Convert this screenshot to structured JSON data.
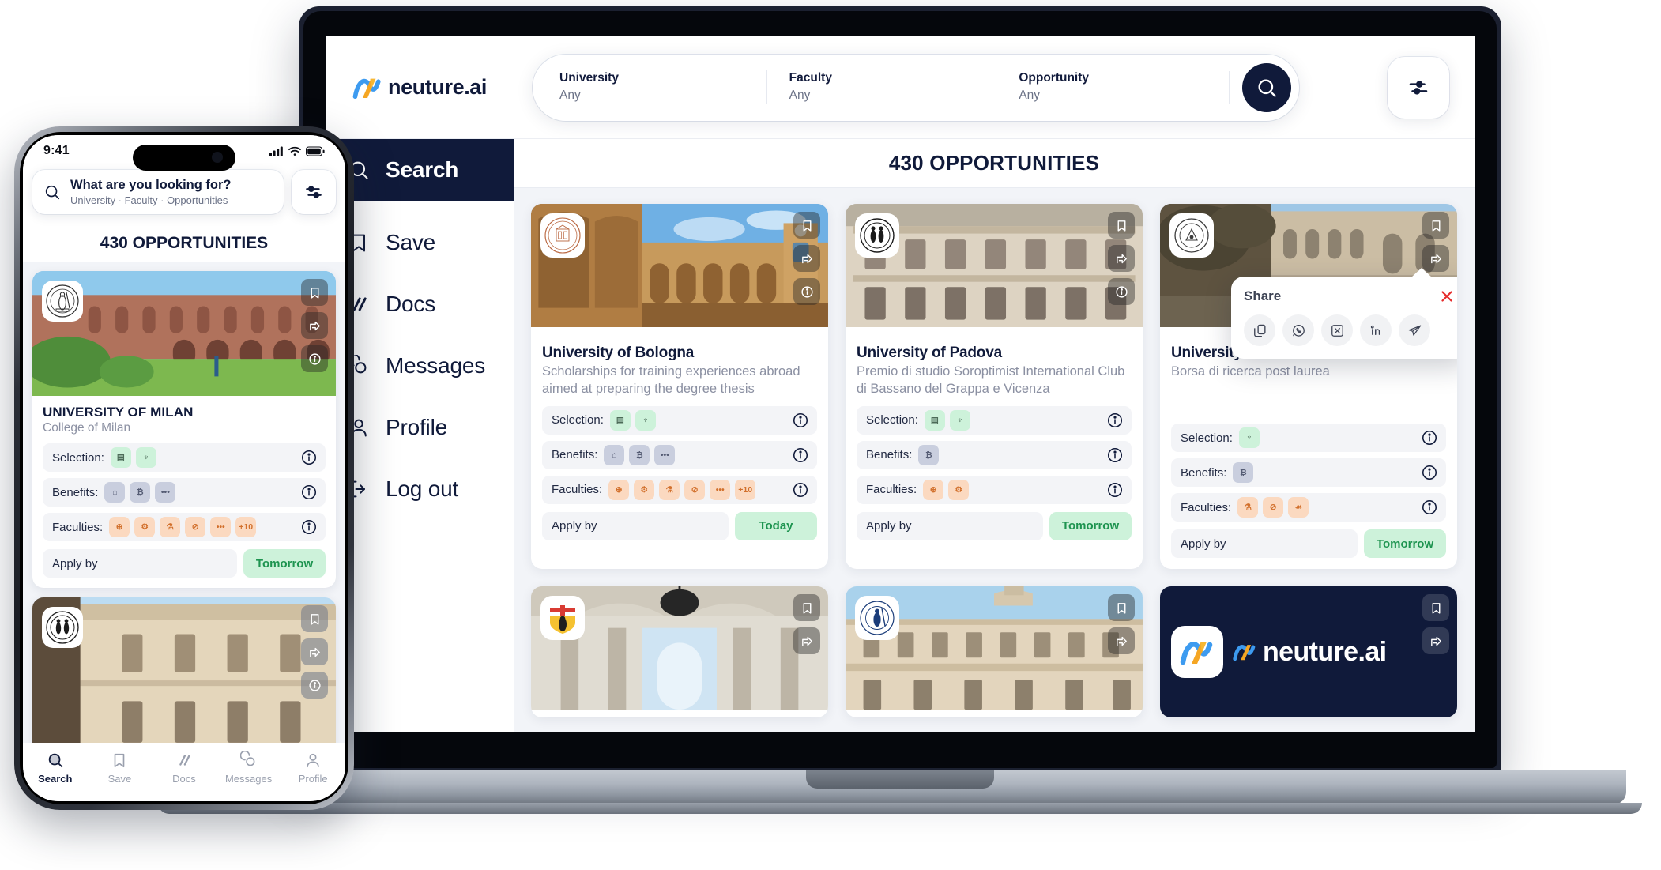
{
  "brand": {
    "name": "neuture.ai",
    "navy": "#101a3a",
    "green": "#cdf2da",
    "green_text": "#1e9450",
    "orange": "#fbd9c0",
    "grey_chip": "#c9cede"
  },
  "desktop": {
    "search": {
      "fields": [
        {
          "label": "University",
          "value": "Any"
        },
        {
          "label": "Faculty",
          "value": "Any"
        },
        {
          "label": "Opportunity",
          "value": "Any"
        }
      ],
      "search_button_icon": "search-icon",
      "filter_button_icon": "filters-icon"
    },
    "sidebar": {
      "items": [
        {
          "label": "Search",
          "icon": "search-icon",
          "active": true
        },
        {
          "label": "Save",
          "icon": "bookmark-icon",
          "active": false
        },
        {
          "label": "Docs",
          "icon": "docs-icon",
          "active": false
        },
        {
          "label": "Messages",
          "icon": "chat-icon",
          "active": false
        },
        {
          "label": "Profile",
          "icon": "user-icon",
          "active": false
        },
        {
          "label": "Log out",
          "icon": "logout-icon",
          "active": false
        }
      ]
    },
    "results_count": "430 OPPORTUNITIES",
    "labels": {
      "selection": "Selection:",
      "benefits": "Benefits:",
      "faculties": "Faculties:",
      "apply_by": "Apply by"
    },
    "cards": [
      {
        "title": "University of Bologna",
        "subtitle": "Scholarships for training experiences abroad aimed at preparing the degree thesis",
        "selection_chips": [
          "doc",
          "medal"
        ],
        "benefits_chips": [
          "home",
          "money",
          "more"
        ],
        "faculties_chips": [
          "globe",
          "wrench",
          "flask",
          "scale",
          "more",
          "+10"
        ],
        "deadline": "Today",
        "logo_text": "ALMA MATER STUDIORUM A.D. 1088",
        "actions": [
          "bookmark-icon",
          "share-icon",
          "info-icon"
        ]
      },
      {
        "title": "University of Padova",
        "subtitle": "Premio di studio Soroptimist International Club di Bassano del Grappa e Vicenza",
        "selection_chips": [
          "doc",
          "medal"
        ],
        "benefits_chips": [
          "money"
        ],
        "faculties_chips": [
          "globe",
          "wrench"
        ],
        "deadline": "Tomorrow",
        "logo_text": "UNIVERSITAS STUDII PADUANI",
        "actions": [
          "bookmark-icon",
          "share-icon",
          "info-icon"
        ]
      },
      {
        "title": "University of Verona",
        "subtitle": "Borsa di ricerca post laurea",
        "selection_chips": [
          "medal"
        ],
        "benefits_chips": [
          "money"
        ],
        "faculties_chips": [
          "flask",
          "scale",
          "person"
        ],
        "deadline": "Tomorrow",
        "logo_text": "UNIVERSITAS STUDIORUM VERONENSIS",
        "actions": [
          "bookmark-icon",
          "share-icon",
          "info-icon"
        ]
      }
    ],
    "share_popup": {
      "title": "Share",
      "close_icon": "close-icon",
      "close_color": "#e52b2b",
      "icons": [
        "link-icon",
        "whatsapp-icon",
        "x-twitter-icon",
        "linkedin-icon",
        "telegram-icon"
      ]
    },
    "bottom_cards": [
      {
        "logo_text": "UNIVERSITY OF GENOA",
        "actions": [
          "bookmark-icon",
          "share-icon"
        ]
      },
      {
        "logo_text": "UNIVERSITAS STUDIORUM PETRI SIBI",
        "actions": [
          "bookmark-icon",
          "share-icon"
        ]
      }
    ],
    "promo_card": {
      "text": "neuture.ai",
      "actions": [
        "bookmark-icon",
        "share-icon"
      ]
    }
  },
  "mobile": {
    "status": {
      "time": "9:41",
      "signal_icon": "cellular-icon",
      "wifi_icon": "wifi-icon",
      "battery_icon": "battery-icon"
    },
    "search": {
      "title": "What are you looking for?",
      "subtitle": "University · Faculty · Opportunities",
      "search_icon": "search-icon",
      "filter_icon": "filters-icon"
    },
    "results_count": "430 OPPORTUNITIES",
    "labels": {
      "selection": "Selection:",
      "benefits": "Benefits:",
      "faculties": "Faculties:",
      "apply_by": "Apply by"
    },
    "cards": [
      {
        "title": "UNIVERSITY OF MILAN",
        "subtitle": "College of Milan",
        "selection_chips": [
          "doc",
          "medal"
        ],
        "benefits_chips": [
          "home",
          "money",
          "more"
        ],
        "faculties_chips": [
          "globe",
          "wrench",
          "flask",
          "scale",
          "more",
          "+10"
        ],
        "deadline": "Tomorrow",
        "logo_text": "UNIVERSITAS STUDIORUM MEDIOLANENSIS",
        "actions": [
          "bookmark-icon",
          "share-icon",
          "info-icon"
        ]
      },
      {
        "title": "",
        "subtitle": "",
        "logo_text": "UNIVERSITAS STUDII PADUANI",
        "actions": [
          "bookmark-icon",
          "share-icon",
          "info-icon"
        ]
      }
    ],
    "tabs": [
      {
        "label": "Search",
        "icon": "search-icon",
        "active": true
      },
      {
        "label": "Save",
        "icon": "bookmark-icon",
        "active": false
      },
      {
        "label": "Docs",
        "icon": "docs-icon",
        "active": false
      },
      {
        "label": "Messages",
        "icon": "chat-icon",
        "active": false
      },
      {
        "label": "Profile",
        "icon": "user-icon",
        "active": false
      }
    ]
  }
}
